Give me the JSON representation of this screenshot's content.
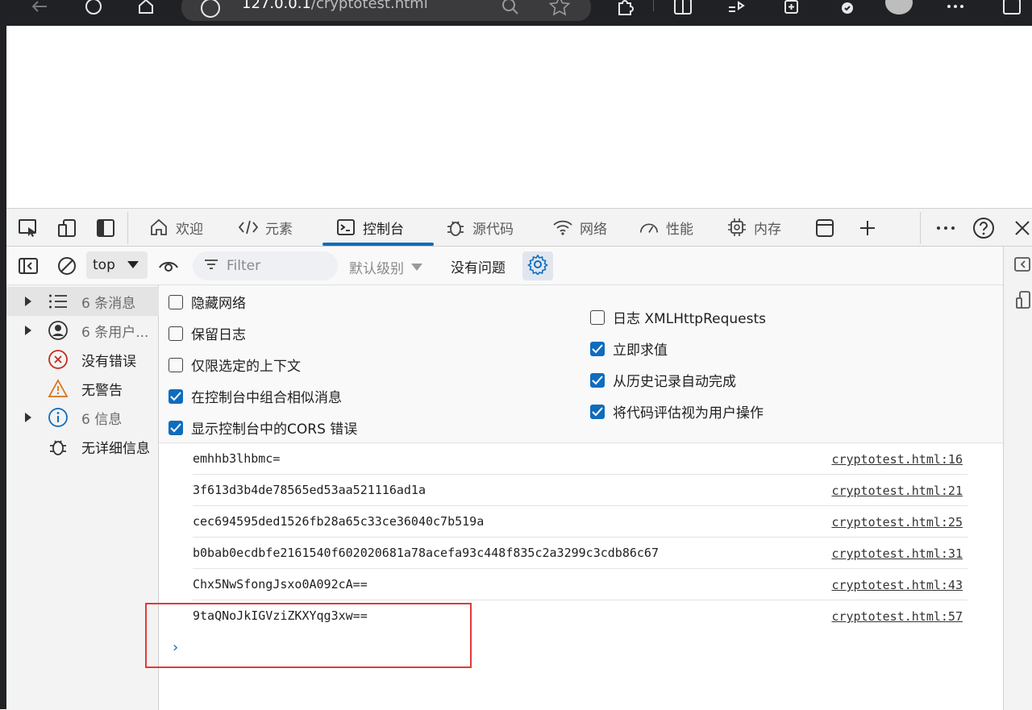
{
  "browser": {
    "address": {
      "host": "127.0.0.1",
      "path": "/cryptotest.html"
    }
  },
  "devtools": {
    "tabs": [
      {
        "id": "welcome",
        "label": "欢迎",
        "icon": "home-icon"
      },
      {
        "id": "elements",
        "label": "元素",
        "icon": "code-icon"
      },
      {
        "id": "console",
        "label": "控制台",
        "icon": "terminal-icon",
        "active": true
      },
      {
        "id": "sources",
        "label": "源代码",
        "icon": "bug-icon"
      },
      {
        "id": "network",
        "label": "网络",
        "icon": "wifi-icon"
      },
      {
        "id": "performance",
        "label": "性能",
        "icon": "gauge-icon"
      },
      {
        "id": "memory",
        "label": "内存",
        "icon": "chip-icon"
      }
    ],
    "accent": "#0f6cbd"
  },
  "toolbar": {
    "context": "top",
    "filter_placeholder": "Filter",
    "levels": "默认级别",
    "issues": "没有问题"
  },
  "sidebar": {
    "items": [
      {
        "label": "6 条消息",
        "icon": "list-icon",
        "expandable": true,
        "selected": true
      },
      {
        "label": "6 条用户...",
        "icon": "user-icon",
        "expandable": true
      },
      {
        "label": "没有错误",
        "icon": "error-icon",
        "expandable": false
      },
      {
        "label": "无警告",
        "icon": "warning-icon",
        "expandable": false
      },
      {
        "label": "6 信息",
        "icon": "info-icon",
        "expandable": true
      },
      {
        "label": "无详细信息",
        "icon": "bug-icon",
        "expandable": false
      }
    ]
  },
  "settings": {
    "left": [
      {
        "label": "隐藏网络",
        "checked": false
      },
      {
        "label": "保留日志",
        "checked": false
      },
      {
        "label": "仅限选定的上下文",
        "checked": false
      },
      {
        "label": "在控制台中组合相似消息",
        "checked": true
      },
      {
        "label": "显示控制台中的CORS 错误",
        "checked": true
      }
    ],
    "right": [
      {
        "label": "日志 XMLHttpRequests",
        "checked": false
      },
      {
        "label": "立即求值",
        "checked": true
      },
      {
        "label": "从历史记录自动完成",
        "checked": true
      },
      {
        "label": "将代码评估视为用户操作",
        "checked": true
      }
    ]
  },
  "console": {
    "messages": [
      {
        "text": "emhhb3lhbmc=",
        "source": "cryptotest.html:16"
      },
      {
        "text": "3f613d3b4de78565ed53aa521116ad1a",
        "source": "cryptotest.html:21"
      },
      {
        "text": "cec694595ded1526fb28a65c33ce36040c7b519a",
        "source": "cryptotest.html:25"
      },
      {
        "text": "b0bab0ecdbfe2161540f602020681a78acefa93c448f835c2a3299c3cdb86c67",
        "source": "cryptotest.html:31"
      },
      {
        "text": "Chx5NwSfongJsxo0A092cA==",
        "source": "cryptotest.html:43"
      },
      {
        "text": "9taQNoJkIGVziZKXYqg3xw==",
        "source": "cryptotest.html:57"
      }
    ],
    "prompt_glyph": "›"
  }
}
